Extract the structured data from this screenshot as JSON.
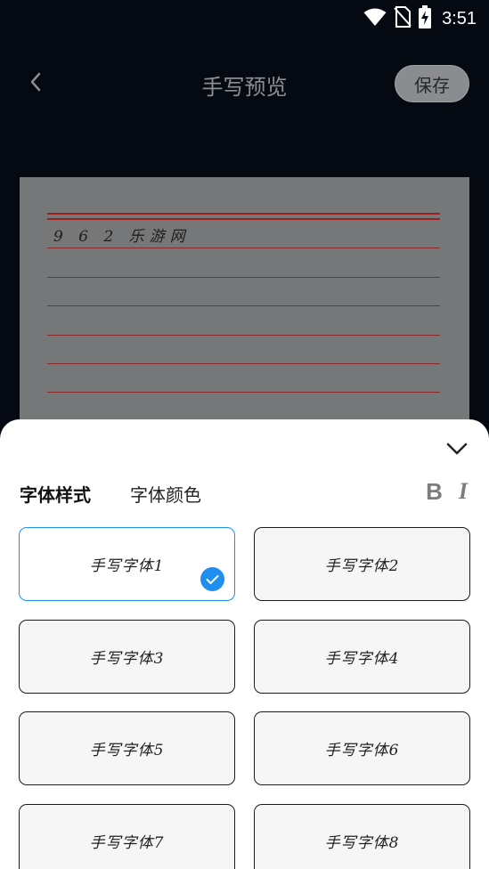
{
  "status_bar": {
    "time": "3:51",
    "icons": [
      "wifi-icon",
      "no-sim-icon",
      "battery-charging-icon"
    ]
  },
  "app_bar": {
    "back_icon": "chevron-left-icon",
    "title": "手写预览",
    "save_label": "保存"
  },
  "preview": {
    "text": "9 6 2 乐游网"
  },
  "sheet": {
    "collapse_icon": "chevron-down-icon",
    "tabs": [
      {
        "label": "字体样式",
        "active": true
      },
      {
        "label": "字体颜色",
        "active": false
      }
    ],
    "toggles": {
      "bold_label": "B",
      "italic_label": "I"
    },
    "fonts": [
      {
        "label": "手写字体1",
        "selected": true
      },
      {
        "label": "手写字体2",
        "selected": false
      },
      {
        "label": "手写字体3",
        "selected": false
      },
      {
        "label": "手写字体4",
        "selected": false
      },
      {
        "label": "手写字体5",
        "selected": false
      },
      {
        "label": "手写字体6",
        "selected": false
      },
      {
        "label": "手写字体7",
        "selected": false
      },
      {
        "label": "手写字体8",
        "selected": false
      }
    ]
  },
  "colors": {
    "accent": "#1f8ef1",
    "background": "#050a12",
    "paper_line": "#a31d1d"
  }
}
